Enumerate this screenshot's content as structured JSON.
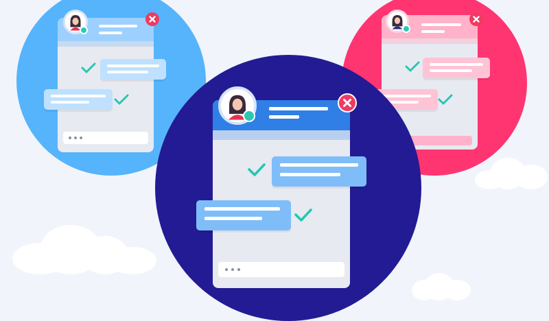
{
  "scene": {
    "colors": {
      "background": "#f1f4fb",
      "left_circle": "#55b4fb",
      "right_circle": "#ff3571",
      "center_circle": "#231b94",
      "check": "#25c7b2",
      "close": "#ef3a61"
    },
    "chat_windows": [
      {
        "id": "left",
        "messages": 2,
        "checks": 2
      },
      {
        "id": "right",
        "messages": 2,
        "checks": 2
      },
      {
        "id": "center",
        "messages": 2,
        "checks": 2
      }
    ],
    "icons": [
      "avatar-icon",
      "close-icon",
      "check-icon",
      "status-dot",
      "typing-dots"
    ]
  }
}
